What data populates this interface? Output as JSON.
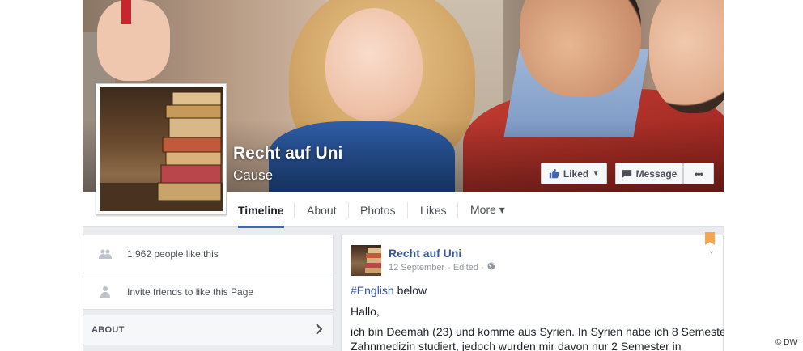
{
  "page": {
    "title": "Recht auf Uni",
    "category": "Cause"
  },
  "cover_buttons": {
    "liked": "Liked",
    "message": "Message",
    "more": "•••"
  },
  "nav": {
    "tabs": [
      {
        "label": "Timeline",
        "active": true
      },
      {
        "label": "About",
        "active": false
      },
      {
        "label": "Photos",
        "active": false
      },
      {
        "label": "Likes",
        "active": false
      },
      {
        "label": "More ▾",
        "active": false
      }
    ]
  },
  "sidebar": {
    "likes_text": "1,962 people like this",
    "invite_text": "Invite friends to like this Page",
    "about_label": "ABOUT"
  },
  "post": {
    "author": "Recht auf Uni",
    "date": "12 September",
    "edited": "· Edited ·",
    "hashtag": "#English",
    "hashtag_rest": " below",
    "line2": "Hallo,",
    "line3": "ich bin Deemah (23) und komme aus Syrien. In Syrien habe ich 8 Semester",
    "line4": "Zahnmedizin studiert, jedoch wurden mir davon nur 2 Semester in"
  },
  "watermark": "© DW",
  "colors": {
    "facebook_blue": "#4267b2",
    "link_blue": "#365899",
    "background": "#e9ebee"
  }
}
